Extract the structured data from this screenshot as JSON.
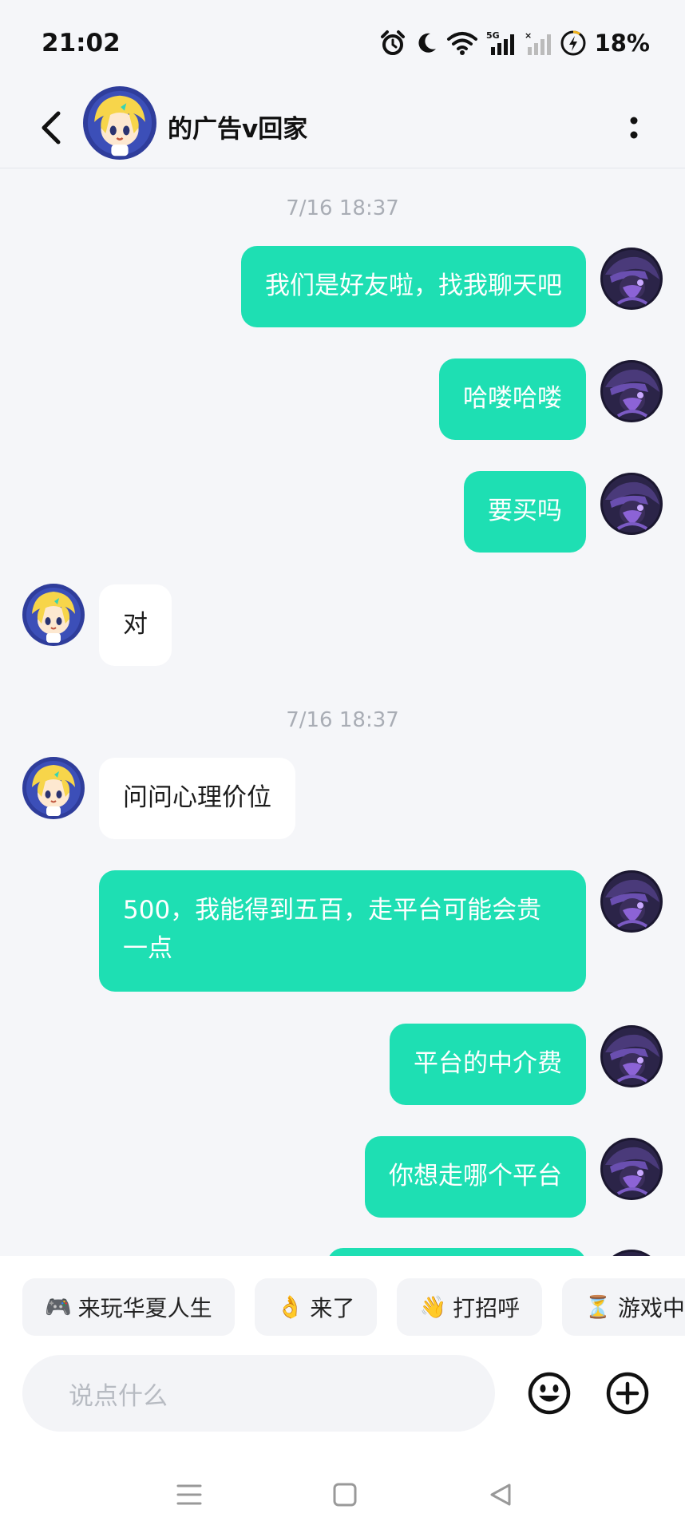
{
  "status_bar": {
    "time": "21:02",
    "battery": "18%",
    "icons": [
      "alarm-icon",
      "moon-icon",
      "wifi-icon",
      "signal-5g-icon",
      "signal-no-sim-icon",
      "battery-charging-icon"
    ]
  },
  "header": {
    "title": "的广告v回家",
    "back_icon": "chevron-left-icon",
    "more_icon": "vertical-dots-icon"
  },
  "messages": [
    {
      "type": "timestamp",
      "text": "7/16  18:37"
    },
    {
      "type": "outgoing",
      "text": "我们是好友啦，找我聊天吧"
    },
    {
      "type": "outgoing",
      "text": "哈喽哈喽"
    },
    {
      "type": "outgoing",
      "text": "要买吗"
    },
    {
      "type": "incoming",
      "text": "对"
    },
    {
      "type": "timestamp",
      "text": "7/16  18:37"
    },
    {
      "type": "incoming",
      "text": "问问心理价位"
    },
    {
      "type": "outgoing",
      "text": "500，我能得到五百，走平台可能会贵一点"
    },
    {
      "type": "outgoing",
      "text": "平台的中介费"
    },
    {
      "type": "outgoing",
      "text": "你想走哪个平台"
    }
  ],
  "quick_replies": [
    {
      "icon": "🎮",
      "label": "来玩华夏人生"
    },
    {
      "icon": "👌",
      "label": "来了"
    },
    {
      "icon": "👋",
      "label": "打招呼"
    },
    {
      "icon": "⏳",
      "label": "游戏中稍"
    }
  ],
  "input": {
    "placeholder": "说点什么"
  },
  "colors": {
    "outgoing_bubble": "#1edfb3",
    "incoming_bubble": "#ffffff",
    "background": "#f5f6f9"
  }
}
